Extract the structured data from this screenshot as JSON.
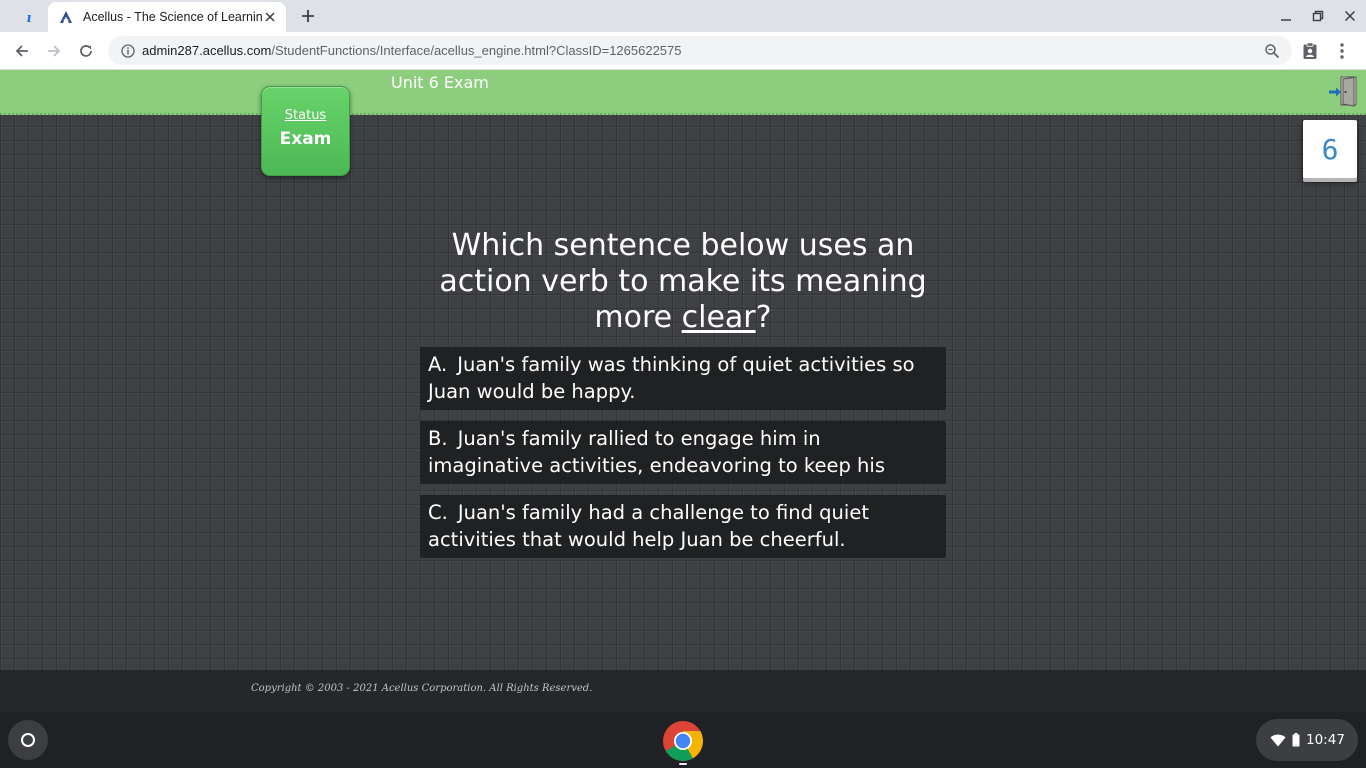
{
  "browser": {
    "tab_title": "Acellus - The Science of Learning",
    "url_host": "admin287.acellus.com",
    "url_path": "/StudentFunctions/Interface/acellus_engine.html?ClassID=1265622575"
  },
  "header": {
    "unit_title": "Unit 6 Exam",
    "status_label": "Status",
    "status_value": "Exam",
    "question_number": "6",
    "color": "#8ccd7e"
  },
  "question": {
    "text_before": "Which sentence below uses an action verb to make its meaning more ",
    "underlined": "clear",
    "text_after": "?"
  },
  "answers": [
    {
      "letter": "A.",
      "text": "Juan's family was thinking of quiet activities so Juan would be happy."
    },
    {
      "letter": "B.",
      "text": "Juan's family rallied to engage him in imaginative activities, endeavoring to keep his spirits up."
    },
    {
      "letter": "C.",
      "text": "Juan's family had a challenge to find quiet activities that would help Juan be cheerful."
    }
  ],
  "footer": {
    "copyright": "Copyright © 2003 - 2021 Acellus Corporation.  All Rights Reserved."
  },
  "shelf": {
    "time": "10:47",
    "apps": [
      "chrome-icon"
    ]
  }
}
